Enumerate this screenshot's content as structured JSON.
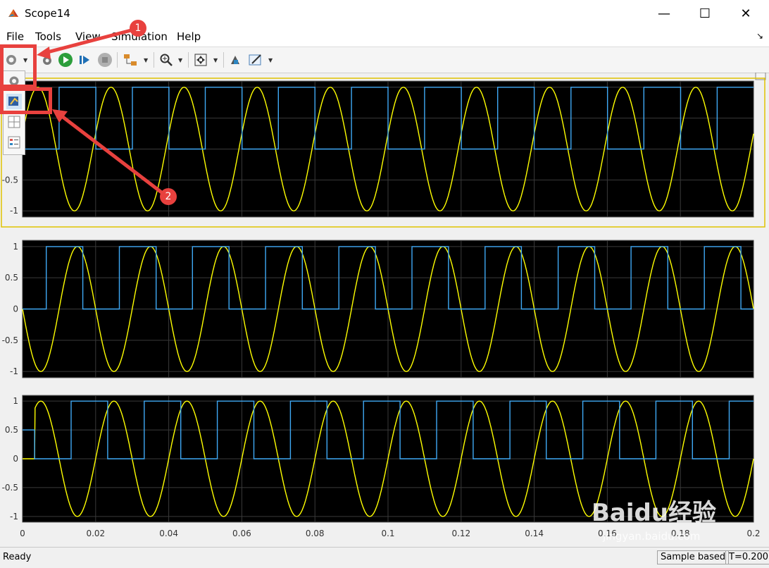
{
  "window": {
    "title": "Scope14",
    "minimize": "—",
    "maximize": "☐",
    "close": "✕"
  },
  "menu": [
    "File",
    "Tools",
    "View",
    "Simulation",
    "Help"
  ],
  "toolbar_icons": [
    "settings-icon",
    "restore-icon",
    "run-icon",
    "step-forward-icon",
    "stop-icon",
    "highlight-block-icon",
    "zoom-in-icon",
    "autoscale-icon",
    "pan-icon",
    "edit-style-icon"
  ],
  "popup_icons": [
    "configuration-properties-icon",
    "style-icon",
    "layout-icon",
    "legend-icon"
  ],
  "annotations": {
    "step1": "1",
    "step2": "2"
  },
  "axes": {
    "yticks_top": [
      "-0.5",
      "-1"
    ],
    "yticks": [
      "1",
      "0.5",
      "0",
      "-0.5",
      "-1"
    ],
    "xticks": [
      "0",
      "0.02",
      "0.04",
      "0.06",
      "0.08",
      "0.1",
      "0.12",
      "0.14",
      "0.16",
      "0.18",
      "0.2"
    ]
  },
  "status": {
    "left": "Ready",
    "mode": "Sample based",
    "time": "T=0.200"
  },
  "watermark": {
    "brand": "Baidu经验",
    "url": "jingyan.baidu.com"
  },
  "colors": {
    "plot_bg": "#000000",
    "grid": "#3a3a3a",
    "sine": "#ffff00",
    "square": "#3fa9f5",
    "annotation": "#e8413e",
    "active_border": "#e0c200"
  },
  "chart_data": [
    {
      "type": "line",
      "title": "",
      "xlim": [
        0,
        0.2
      ],
      "ylim": [
        -1.1,
        1.1
      ],
      "grid": true,
      "series": [
        {
          "kind": "sine",
          "frequency_hz": 50,
          "phase_rad": 0.25,
          "amplitude": 1
        },
        {
          "kind": "pulse",
          "period_s": 0.02,
          "high": 1,
          "low": 0,
          "rising_edges_at": 0.01,
          "duty": 0.5
        }
      ]
    },
    {
      "type": "line",
      "title": "",
      "xlim": [
        0,
        0.2
      ],
      "ylim": [
        -1.1,
        1.1
      ],
      "grid": true,
      "series": [
        {
          "kind": "sine",
          "frequency_hz": 50,
          "phase_rad": 3.14,
          "amplitude": 1
        },
        {
          "kind": "pulse",
          "period_s": 0.02,
          "high": 1,
          "low": 0,
          "rising_edges_at": 0.0065,
          "duty": 0.5
        }
      ]
    },
    {
      "type": "line",
      "title": "",
      "xlim": [
        0,
        0.2
      ],
      "ylim": [
        -1.1,
        1.1
      ],
      "grid": true,
      "series": [
        {
          "kind": "sine",
          "frequency_hz": 50,
          "phase_rad": 0,
          "amplitude": 1,
          "start_delay": 0.0033
        },
        {
          "kind": "pulse",
          "period_s": 0.02,
          "high": 1,
          "low": 0,
          "rising_edges_at": 0.0133,
          "duty": 0.5,
          "initial_value": 0.5,
          "initial_until": 0.0033
        }
      ]
    }
  ]
}
